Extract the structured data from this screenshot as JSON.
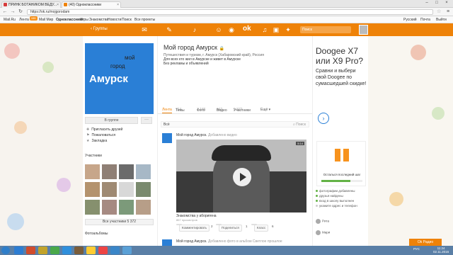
{
  "browser": {
    "tabs": [
      {
        "title": "ПРИНК БОТАНИКОМ ВЕДУ...",
        "fav": "#d63b3b"
      },
      {
        "title": "(40) Одноклассники",
        "fav": "#ee8208"
      }
    ],
    "url": "https://ok.ru/mojgorodam",
    "bookmarks": [
      "Mail.Ru",
      "Лента",
      "Mail Мир",
      "Одноклассники",
      "Игры",
      "Знакомства",
      "Новости",
      "Поиск",
      "Все проекты",
      "Русский",
      "Почта",
      "Выйти"
    ],
    "feed_badge": "159"
  },
  "okbar": {
    "back_label": "Группы",
    "logo": "ok",
    "search_placeholder": "Поиск"
  },
  "group": {
    "image_text_1": "мой",
    "image_text_2": "город",
    "image_text_3": "Амурск",
    "in_group_button": "В группе",
    "more_button": "···",
    "menu": [
      "Пригласить друзей",
      "Пожаловаться",
      "Закладка"
    ],
    "members_title": "Участники",
    "all_members_button": "Все участники 5 372",
    "photos_title": "Фотоальбомы"
  },
  "main": {
    "title": "Мой город Амурск",
    "desc_lines": [
      "Путешествия и туризм, г. Амурск (Хабаровский край), Россия",
      "Для всех кто жил в Амурске и живет в Амурске",
      "Без рекламы и объявлений"
    ],
    "tabs": [
      {
        "label": "Лента",
        "count": ""
      },
      {
        "label": "Темы",
        "count": "764"
      },
      {
        "label": "Фото",
        "count": "7 186"
      },
      {
        "label": "Видео",
        "count": "642"
      },
      {
        "label": "Участники",
        "count": "5 872"
      },
      {
        "label": "Ещё ▾",
        "count": ""
      }
    ],
    "filter_all": "Всё",
    "filter_search": "Поиск",
    "post1": {
      "author": "Мой город Амурск.",
      "action": "Добавлено видео",
      "duration": "5:14",
      "video_title": "Знакомства у аборигена",
      "views": "867 просмотров",
      "comment_label": "Комментировать",
      "comment_count": "2",
      "share_label": "Поделиться",
      "share_count": "1",
      "like_label": "Класс",
      "like_count": "6"
    },
    "post2": {
      "author": "Мой город Амурск.",
      "action": "Добавлено фото в альбом Светлое прошлое"
    }
  },
  "ad": {
    "headline": "Doogee X7 или X9 Pro?",
    "text": "Сравни и выбери свой Doogee по сумасшедшей скидке!",
    "arrow": "›",
    "gift_text": "Осталься последний шаг",
    "gift_progress": 0.7,
    "status": [
      "фотографии добавлены",
      "друзья найдены",
      "вход в школу выполнен",
      "укажите адрес и телефон"
    ],
    "chat": [
      "Рита",
      "Мари"
    ]
  },
  "taskbar": {
    "tray": "РУС",
    "time": "11:24",
    "date": "02.11.2016",
    "ok_float": "Ok Радио",
    "apps": [
      "#2d7dd2",
      "#d14c2c",
      "#c2a32b",
      "#4aa84a",
      "#2f8fdc",
      "#7a5d3b",
      "#ffcc33",
      "#e44",
      "#3a86c8",
      "#5aa0d6"
    ]
  },
  "colors": {
    "accent": "#ee8208",
    "blue": "#2a7fd6"
  }
}
